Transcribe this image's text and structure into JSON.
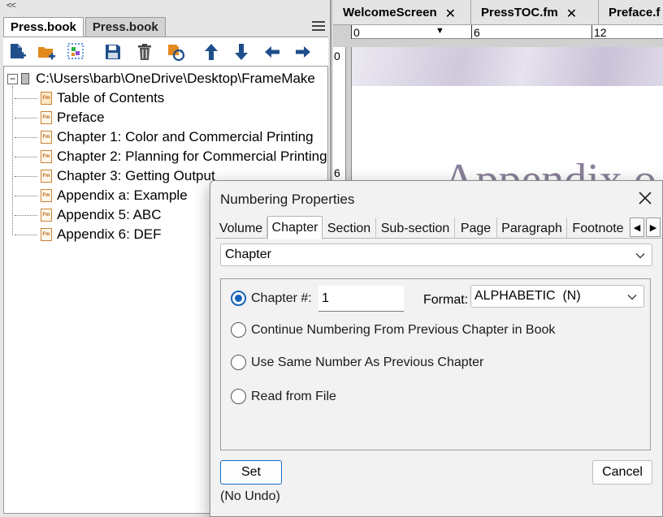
{
  "book_panel": {
    "collapse_label": "<<",
    "tabs": [
      {
        "label": "Press.book"
      },
      {
        "label": "Press.book"
      }
    ],
    "toolbar_icons": [
      "add-file-icon",
      "add-folder-icon",
      "add-group-icon",
      "save-icon",
      "delete-icon",
      "update-book-icon",
      "move-up-icon",
      "move-down-icon",
      "move-left-icon",
      "move-right-icon"
    ],
    "tree": {
      "root_expander": "−",
      "root_label": "C:\\Users\\barb\\OneDrive\\Desktop\\FrameMake",
      "items": [
        {
          "label": "Table of Contents"
        },
        {
          "label": "Preface"
        },
        {
          "label": "Chapter 1: Color and Commercial Printing"
        },
        {
          "label": "Chapter 2: Planning for Commercial Printing"
        },
        {
          "label": "Chapter 3: Getting Output"
        },
        {
          "label": "Appendix a: Example"
        },
        {
          "label": "Appendix 5: ABC"
        },
        {
          "label": "Appendix 6: DEF"
        }
      ]
    }
  },
  "document": {
    "tabs": [
      {
        "label": "WelcomeScreen",
        "close": "✕"
      },
      {
        "label": "PressTOC.fm",
        "close": "✕"
      },
      {
        "label": "Preface.f",
        "close": ""
      }
    ],
    "ruler": {
      "marker": "▼",
      "nums": [
        "0",
        "6",
        "12"
      ]
    },
    "side_ruler": {
      "nums": [
        "0",
        "6"
      ]
    },
    "page_heading": "Appendix o"
  },
  "dialog": {
    "title": "Numbering Properties",
    "tabs": [
      "Volume",
      "Chapter",
      "Section",
      "Sub-section",
      "Page",
      "Paragraph",
      "Footnote"
    ],
    "active_tab_index": 1,
    "scroll_left": "◀",
    "scroll_right": "▶",
    "scope_value": "Chapter",
    "options": [
      {
        "label": "Chapter #:"
      },
      {
        "label": "Continue Numbering From Previous Chapter in Book"
      },
      {
        "label": "Use Same Number As Previous Chapter"
      },
      {
        "label": "Read from File"
      }
    ],
    "selected_option_index": 0,
    "chapter_number": "1",
    "format_label": "Format:",
    "format_value": "ALPHABETIC  (N)",
    "set_label": "Set",
    "cancel_label": "Cancel",
    "no_undo_label": "(No Undo)",
    "accent_color": "#1663b8"
  }
}
